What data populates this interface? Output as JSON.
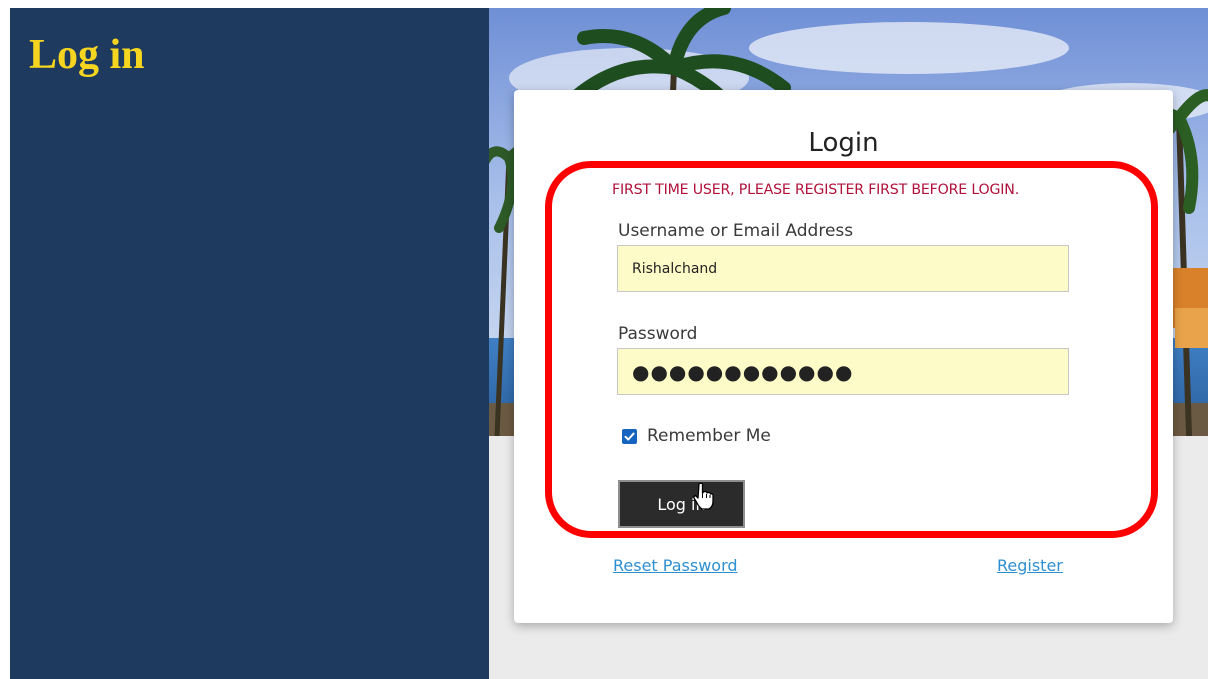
{
  "page": {
    "title": "Log in"
  },
  "login_form": {
    "heading": "Login",
    "notice": "FIRST TIME USER, PLEASE REGISTER FIRST BEFORE LOGIN.",
    "username_label": "Username or Email Address",
    "username_value": "Rishalchand",
    "password_label": "Password",
    "password_value": "●●●●●●●●●●●●",
    "remember_label": "Remember Me",
    "remember_checked": true,
    "submit_label": "Log in",
    "reset_link": "Reset Password",
    "register_link": "Register"
  },
  "colors": {
    "left_panel": "#1f3a5f",
    "title": "#f5d51f",
    "notice": "#b0123b",
    "input_bg": "#fdfcc8",
    "link": "#2f8fd0",
    "button_bg": "#2b2b2b",
    "highlight": "#ff0000"
  },
  "icons": {
    "checkbox": "checkmark-icon",
    "cursor": "hand-pointer-icon"
  }
}
